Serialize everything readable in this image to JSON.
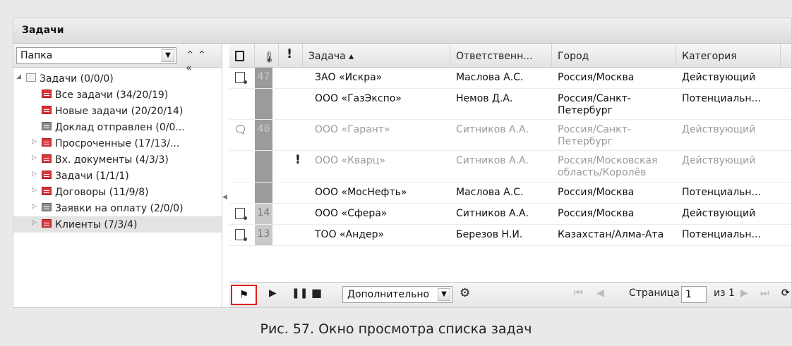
{
  "window": {
    "title": "Задачи"
  },
  "folder_panel": {
    "select_value": "Папка",
    "collapse_label": "⌃⌃ «",
    "tree": [
      {
        "label": "Задачи (0/0/0)",
        "icon": "folder-icon",
        "expanded": true
      },
      {
        "label": "Все задачи (34/20/19)",
        "icon": "red-folder-icon"
      },
      {
        "label": "Новые задачи (20/20/14)",
        "icon": "red-folder-icon"
      },
      {
        "label": "Доклад отправлен (0/0...",
        "icon": "grey-folder-icon"
      },
      {
        "label": "Просроченные (17/13/...",
        "icon": "red-folder-icon"
      },
      {
        "label": "Вх. документы (4/3/3)",
        "icon": "red-folder-icon"
      },
      {
        "label": "Задачи (1/1/1)",
        "icon": "red-folder-icon"
      },
      {
        "label": "Договоры (11/9/8)",
        "icon": "red-folder-icon"
      },
      {
        "label": "Заявки на оплату (2/0/0)",
        "icon": "grey-folder-icon"
      },
      {
        "label": "Клиенты (7/3/4)",
        "icon": "red-folder-icon",
        "selected": true
      }
    ]
  },
  "grid": {
    "columns": {
      "task": "Задача ▴",
      "responsible": "Ответственн...",
      "city": "Город",
      "category": "Категория"
    },
    "rows": [
      {
        "icon": "doc",
        "temp": "47",
        "temp_style": "dark",
        "flag": "",
        "task": "ЗАО «Искра»",
        "responsible": "Маслова А.С.",
        "city": "Россия/Москва",
        "category": "Действующий",
        "dim": false
      },
      {
        "icon": "",
        "temp": "",
        "temp_style": "dark",
        "flag": "",
        "task": "ООО «ГазЭкспо»",
        "responsible": "Немов Д.А.",
        "city": "Россия/Санкт-Петербург",
        "category": "Потенциальн...",
        "dim": false
      },
      {
        "icon": "comment",
        "temp": "48",
        "temp_style": "dark",
        "flag": "",
        "task": "ООО «Гарант»",
        "responsible": "Ситников А.А.",
        "city": "Россия/Санкт-Петербург",
        "category": "Действующий",
        "dim": true
      },
      {
        "icon": "",
        "temp": "",
        "temp_style": "dark",
        "flag": "!",
        "task": "ООО «Кварц»",
        "responsible": "Ситников А.А.",
        "city": "Россия/Московская область/Королёв",
        "category": "Действующий",
        "dim": true
      },
      {
        "icon": "",
        "temp": "",
        "temp_style": "dark",
        "flag": "",
        "task": "ООО «МосНефть»",
        "responsible": "Маслова А.С.",
        "city": "Россия/Москва",
        "category": "Потенциальн...",
        "dim": false
      },
      {
        "icon": "doc",
        "temp": "14",
        "temp_style": "light",
        "flag": "",
        "task": "ООО «Сфера»",
        "responsible": "Ситников А.А.",
        "city": "Россия/Москва",
        "category": "Действующий",
        "dim": false
      },
      {
        "icon": "doc",
        "temp": "13",
        "temp_style": "light",
        "flag": "",
        "task": "ТОО «Андер»",
        "responsible": "Березов Н.И.",
        "city": "Казахстан/Алма-Ата",
        "category": "Потенциальн...",
        "dim": false
      }
    ]
  },
  "toolbar": {
    "extra_select": "Дополнительно",
    "page_label": "Страница",
    "page_value": "1",
    "of_label": "из 1"
  },
  "caption": "Рис. 57. Окно просмотра списка задач"
}
